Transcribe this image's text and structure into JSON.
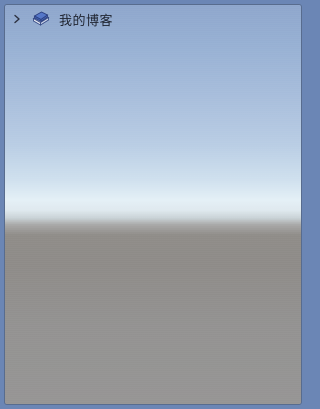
{
  "tree": {
    "items": [
      {
        "label": "我的博客",
        "expander_icon": "chevron-right-icon",
        "icon": "book-icon"
      }
    ]
  },
  "colors": {
    "frame_background": "#6b86b5",
    "sky_top": "#8ea6cc",
    "horizon": "#e4f0f6",
    "ground": "#8e8b88",
    "text": "#1f2430",
    "book_cover": "#5577c8"
  }
}
